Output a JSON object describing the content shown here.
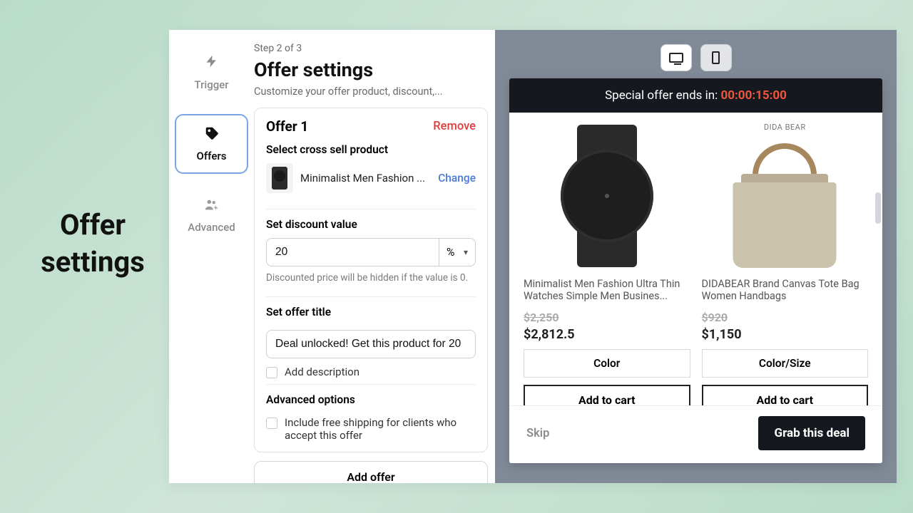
{
  "outer_title": "Offer settings",
  "sidebar": {
    "items": [
      {
        "label": "Trigger"
      },
      {
        "label": "Offers"
      },
      {
        "label": "Advanced"
      }
    ]
  },
  "header": {
    "step": "Step 2 of 3",
    "title": "Offer settings",
    "description": "Customize your offer product, discount,..."
  },
  "offer": {
    "name": "Offer 1",
    "remove_label": "Remove",
    "cross_sell_label": "Select cross sell product",
    "product_name": "Minimalist Men Fashion ...",
    "change_label": "Change",
    "discount_label": "Set discount value",
    "discount_value": "20",
    "discount_unit": "%",
    "discount_hint": "Discounted price will be hidden if the value is 0.",
    "title_label": "Set offer title",
    "title_value": "Deal unlocked! Get this product for 20",
    "add_desc_label": "Add description",
    "advanced_label": "Advanced options",
    "free_ship_label": "Include free shipping for clients who accept this offer",
    "add_offer_btn": "Add offer"
  },
  "preview": {
    "banner_text": "Special offer ends in: ",
    "timer": "00:00:15:00",
    "products": [
      {
        "brand": "",
        "title": "Minimalist Men Fashion Ultra Thin Watches Simple Men Busines...",
        "price_old": "$2,250",
        "price_new": "$2,812.5",
        "option_label": "Color",
        "add_label": "Add to cart"
      },
      {
        "brand": "DIDA BEAR",
        "title": "DIDABEAR Brand Canvas Tote Bag Women Handbags",
        "price_old": "$920",
        "price_new": "$1,150",
        "option_label": "Color/Size",
        "add_label": "Add to cart"
      }
    ],
    "skip_label": "Skip",
    "grab_label": "Grab this deal"
  }
}
